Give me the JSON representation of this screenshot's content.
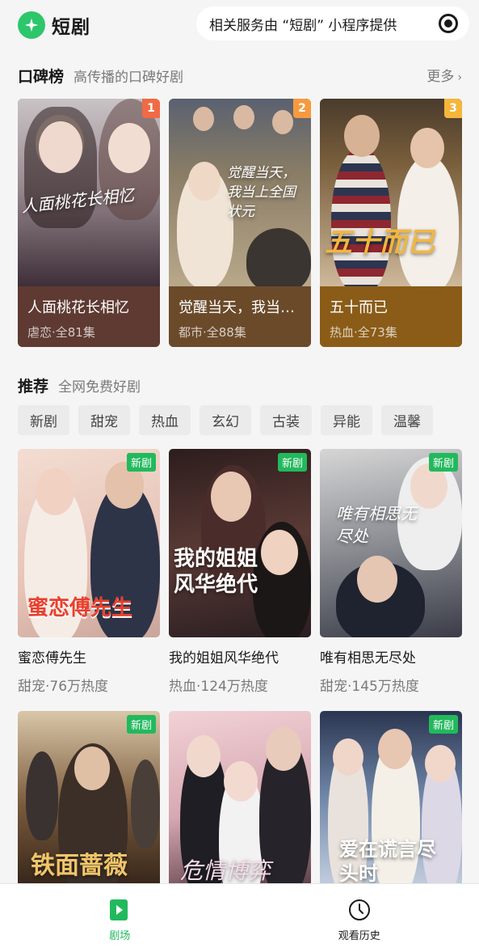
{
  "header": {
    "app_name": "短剧",
    "service_text": "相关服务由 “短剧” 小程序提供",
    "brand_color": "#2dc66b"
  },
  "ranking": {
    "title": "口碑榜",
    "subtitle": "高传播的口碑好剧",
    "more_label": "更多",
    "cards": [
      {
        "rank": "1",
        "title": "人面桃花长相忆",
        "meta": "虐恋·全81集",
        "poster_text": "人面桃花长相忆",
        "badge_color": "#f06a45",
        "info_color": "#5e3a32"
      },
      {
        "rank": "2",
        "title": "觉醒当天，我当…",
        "meta": "都市·全88集",
        "poster_text": "觉醒当天，我当上全国状元",
        "badge_color": "#f59a3f",
        "info_color": "#6b4a2a"
      },
      {
        "rank": "3",
        "title": "五十而已",
        "meta": "热血·全73集",
        "poster_text": "五十而已",
        "badge_color": "#f5b63a",
        "info_color": "#8a5c18"
      }
    ]
  },
  "recommend": {
    "title": "推荐",
    "subtitle": "全网免费好剧",
    "tags": [
      "新剧",
      "甜宠",
      "热血",
      "玄幻",
      "古装",
      "异能",
      "温馨"
    ],
    "new_badge": "新剧",
    "items": [
      {
        "title": "蜜恋傅先生",
        "meta": "甜宠·76万热度",
        "poster_text": "蜜恋傅先生",
        "has_badge": true
      },
      {
        "title": "我的姐姐风华绝代",
        "meta": "热血·124万热度",
        "poster_text": "我的姐姐风华绝代",
        "has_badge": true
      },
      {
        "title": "唯有相思无尽处",
        "meta": "甜宠·145万热度",
        "poster_text": "唯有相思无尽处",
        "has_badge": true
      },
      {
        "title": "",
        "meta": "",
        "poster_text": "铁面蔷薇",
        "has_badge": true
      },
      {
        "title": "",
        "meta": "",
        "poster_text": "危情博弈",
        "has_badge": false
      },
      {
        "title": "",
        "meta": "",
        "poster_text": "爱在谎言尽头时",
        "has_badge": true
      }
    ]
  },
  "bottom_nav": {
    "items": [
      {
        "label": "剧场",
        "icon": "play-icon",
        "active": true
      },
      {
        "label": "观看历史",
        "icon": "clock-icon",
        "active": false
      }
    ],
    "active_color": "#22b95d"
  }
}
